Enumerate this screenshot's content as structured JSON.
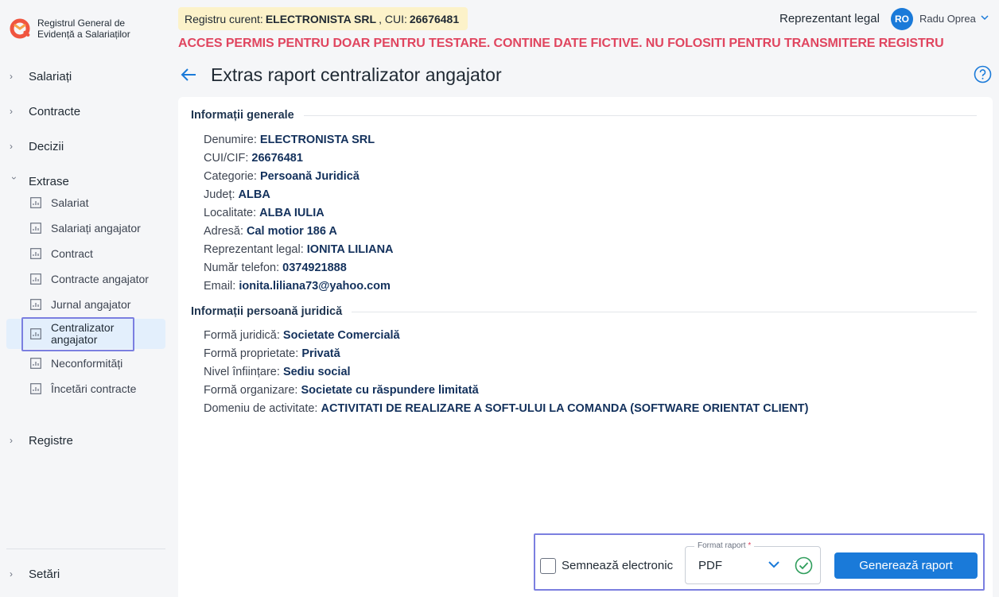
{
  "app": {
    "logo_text": "Registrul General de Evidență a Salariaților"
  },
  "sidebar": {
    "groups": {
      "salariati": "Salariați",
      "contracte": "Contracte",
      "decizii": "Decizii",
      "extrase": "Extrase",
      "registre": "Registre",
      "setari": "Setări"
    },
    "extrase_items": [
      "Salariat",
      "Salariați angajator",
      "Contract",
      "Contracte angajator",
      "Jurnal angajator",
      "Centralizator angajator",
      "Neconformități",
      "Încetări contracte"
    ],
    "active_item": "Centralizator angajator"
  },
  "header": {
    "registry_prefix": "Registru curent:",
    "registry_company": "ELECTRONISTA SRL",
    "registry_cui_label": ", CUI:",
    "registry_cui": "26676481",
    "role": "Reprezentant legal",
    "avatar_initials": "RO",
    "user_name": "Radu Oprea",
    "warning": "ACCES PERMIS PENTRU DOAR PENTRU TESTARE. CONTINE DATE FICTIVE. NU FOLOSITI PENTRU TRANSMITERE REGISTRU"
  },
  "page": {
    "title": "Extras raport centralizator angajator"
  },
  "general_info": {
    "section_title": "Informații generale",
    "rows": [
      {
        "label": "Denumire:",
        "value": "ELECTRONISTA SRL"
      },
      {
        "label": "CUI/CIF:",
        "value": "26676481"
      },
      {
        "label": "Categorie:",
        "value": "Persoană Juridică"
      },
      {
        "label": "Județ:",
        "value": "ALBA"
      },
      {
        "label": "Localitate:",
        "value": "ALBA IULIA"
      },
      {
        "label": "Adresă:",
        "value": "Cal motior 186 A"
      },
      {
        "label": "Reprezentant legal:",
        "value": "IONITA LILIANA"
      },
      {
        "label": "Număr telefon:",
        "value": "0374921888"
      },
      {
        "label": "Email:",
        "value": "ionita.liliana73@yahoo.com"
      }
    ]
  },
  "legal_info": {
    "section_title": "Informații persoană juridică",
    "rows": [
      {
        "label": "Formă juridică:",
        "value": "Societate Comercială"
      },
      {
        "label": "Formă proprietate:",
        "value": "Privată"
      },
      {
        "label": "Nivel înființare:",
        "value": "Sediu social"
      },
      {
        "label": "Formă organizare:",
        "value": "Societate cu răspundere limitată"
      },
      {
        "label": "Domeniu de activitate:",
        "value": "ACTIVITATI DE REALIZARE A SOFT-ULUI LA COMANDA (SOFTWARE ORIENTAT CLIENT)"
      }
    ]
  },
  "actions": {
    "sign_label": "Semnează electronic",
    "sign_checked": false,
    "format_label": "Format raport",
    "format_required_mark": "*",
    "format_value": "PDF",
    "generate_label": "Generează raport"
  },
  "colors": {
    "accent": "#1a7ad9",
    "warning": "#e0455f",
    "registry_pill": "#fcf2c9",
    "highlight_frame": "#7b7fe0",
    "success": "#2e9d5b"
  }
}
